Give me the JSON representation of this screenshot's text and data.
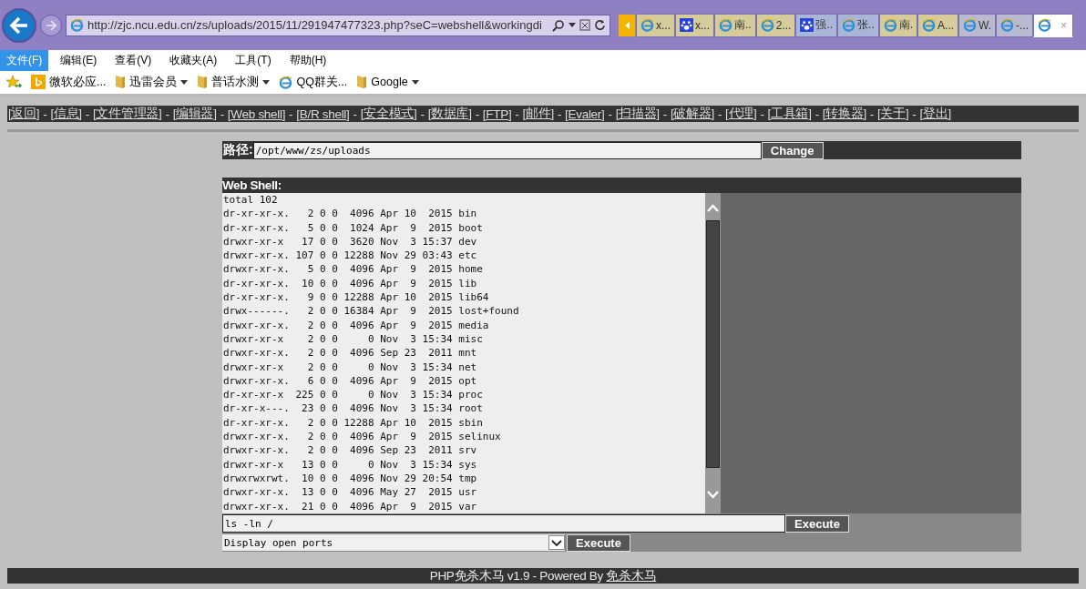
{
  "browser": {
    "address": "http://zjc.ncu.edu.cn/zs/uploads/2015/11/291947477323.php?seC=webshell&workingdi",
    "tabs": [
      {
        "label": "x...",
        "kind": "ie",
        "selected": false,
        "color": "#d6cc9b"
      },
      {
        "label": "x...",
        "kind": "paw",
        "selected": false,
        "color": "#d6cc9b"
      },
      {
        "label": "南..",
        "kind": "ie",
        "selected": false,
        "color": "#d6cc9b"
      },
      {
        "label": "2...",
        "kind": "ie",
        "selected": false,
        "color": "#d6cc9b"
      },
      {
        "label": "强..",
        "kind": "paw",
        "selected": false,
        "color": "#a9b6d8"
      },
      {
        "label": "张..",
        "kind": "ie",
        "selected": false,
        "color": "#a9b6d8"
      },
      {
        "label": "南.",
        "kind": "ie",
        "selected": false,
        "color": "#d6cc9b"
      },
      {
        "label": "A...",
        "kind": "ie",
        "selected": false,
        "color": "#d6cc9b"
      },
      {
        "label": "W.",
        "kind": "ie",
        "selected": false,
        "color": "#b9b9cf"
      },
      {
        "label": "-...",
        "kind": "ie",
        "selected": false,
        "color": "#b9b9cf"
      },
      {
        "label": "×",
        "kind": "ie",
        "selected": true,
        "color": "#ffffff"
      }
    ],
    "menu": [
      {
        "label": "文件(F)",
        "selected": true
      },
      {
        "label": "编辑(E)",
        "selected": false
      },
      {
        "label": "查看(V)",
        "selected": false
      },
      {
        "label": "收藏夹(A)",
        "selected": false
      },
      {
        "label": "工具(T)",
        "selected": false
      },
      {
        "label": "帮助(H)",
        "selected": false
      }
    ],
    "favorites": [
      {
        "label": "微软必应...",
        "kind": "bing",
        "dropdown": false
      },
      {
        "label": "迅雷会员",
        "kind": "folder",
        "dropdown": true
      },
      {
        "label": "普话水测",
        "kind": "folder",
        "dropdown": true
      },
      {
        "label": "QQ群关...",
        "kind": "ie",
        "dropdown": false
      },
      {
        "label": "Google",
        "kind": "folder",
        "dropdown": true
      }
    ]
  },
  "nav_links": [
    "[返回]",
    "[信息]",
    "[文件管理器]",
    "[编辑器]",
    "[Web shell]",
    "[B/R shell]",
    "[安全模式]",
    "[数据库]",
    "[FTP]",
    "[邮件]",
    "[Evaler]",
    "[扫描器]",
    "[破解器]",
    "[代理]",
    "[工具箱]",
    "[转换器]",
    "[关于]",
    "[登出]"
  ],
  "nav_separator": "-",
  "path": {
    "label": "路径:",
    "value": "/opt/www/zs/uploads",
    "button": "Change"
  },
  "webshell": {
    "title": "Web Shell:",
    "output": [
      "total 102",
      "dr-xr-xr-x.   2 0 0  4096 Apr 10  2015 bin",
      "dr-xr-xr-x.   5 0 0  1024 Apr  9  2015 boot",
      "drwxr-xr-x   17 0 0  3620 Nov  3 15:37 dev",
      "drwxr-xr-x. 107 0 0 12288 Nov 29 03:43 etc",
      "drwxr-xr-x.   5 0 0  4096 Apr  9  2015 home",
      "dr-xr-xr-x.  10 0 0  4096 Apr  9  2015 lib",
      "dr-xr-xr-x.   9 0 0 12288 Apr 10  2015 lib64",
      "drwx------.   2 0 0 16384 Apr  9  2015 lost+found",
      "drwxr-xr-x.   2 0 0  4096 Apr  9  2015 media",
      "drwxr-xr-x    2 0 0     0 Nov  3 15:34 misc",
      "drwxr-xr-x.   2 0 0  4096 Sep 23  2011 mnt",
      "drwxr-xr-x    2 0 0     0 Nov  3 15:34 net",
      "drwxr-xr-x.   6 0 0  4096 Apr  9  2015 opt",
      "dr-xr-xr-x  225 0 0     0 Nov  3 15:34 proc",
      "dr-xr-x---.  23 0 0  4096 Nov  3 15:34 root",
      "dr-xr-xr-x.   2 0 0 12288 Apr 10  2015 sbin",
      "drwxr-xr-x.   2 0 0  4096 Apr  9  2015 selinux",
      "drwxr-xr-x.   2 0 0  4096 Sep 23  2011 srv",
      "drwxr-xr-x   13 0 0     0 Nov  3 15:34 sys",
      "drwxrwxrwt.  10 0 0  4096 Nov 29 20:54 tmp",
      "drwxr-xr-x.  13 0 0  4096 May 27  2015 usr",
      "drwxr-xr-x.  21 0 0  4096 Apr  9  2015 var"
    ],
    "command": "ls -ln /",
    "execute": "Execute",
    "preset": "Display open ports",
    "preset_execute": "Execute"
  },
  "footer": {
    "text": "PHP免杀木马 v1.9 - Powered By ",
    "link": "免杀木马"
  }
}
